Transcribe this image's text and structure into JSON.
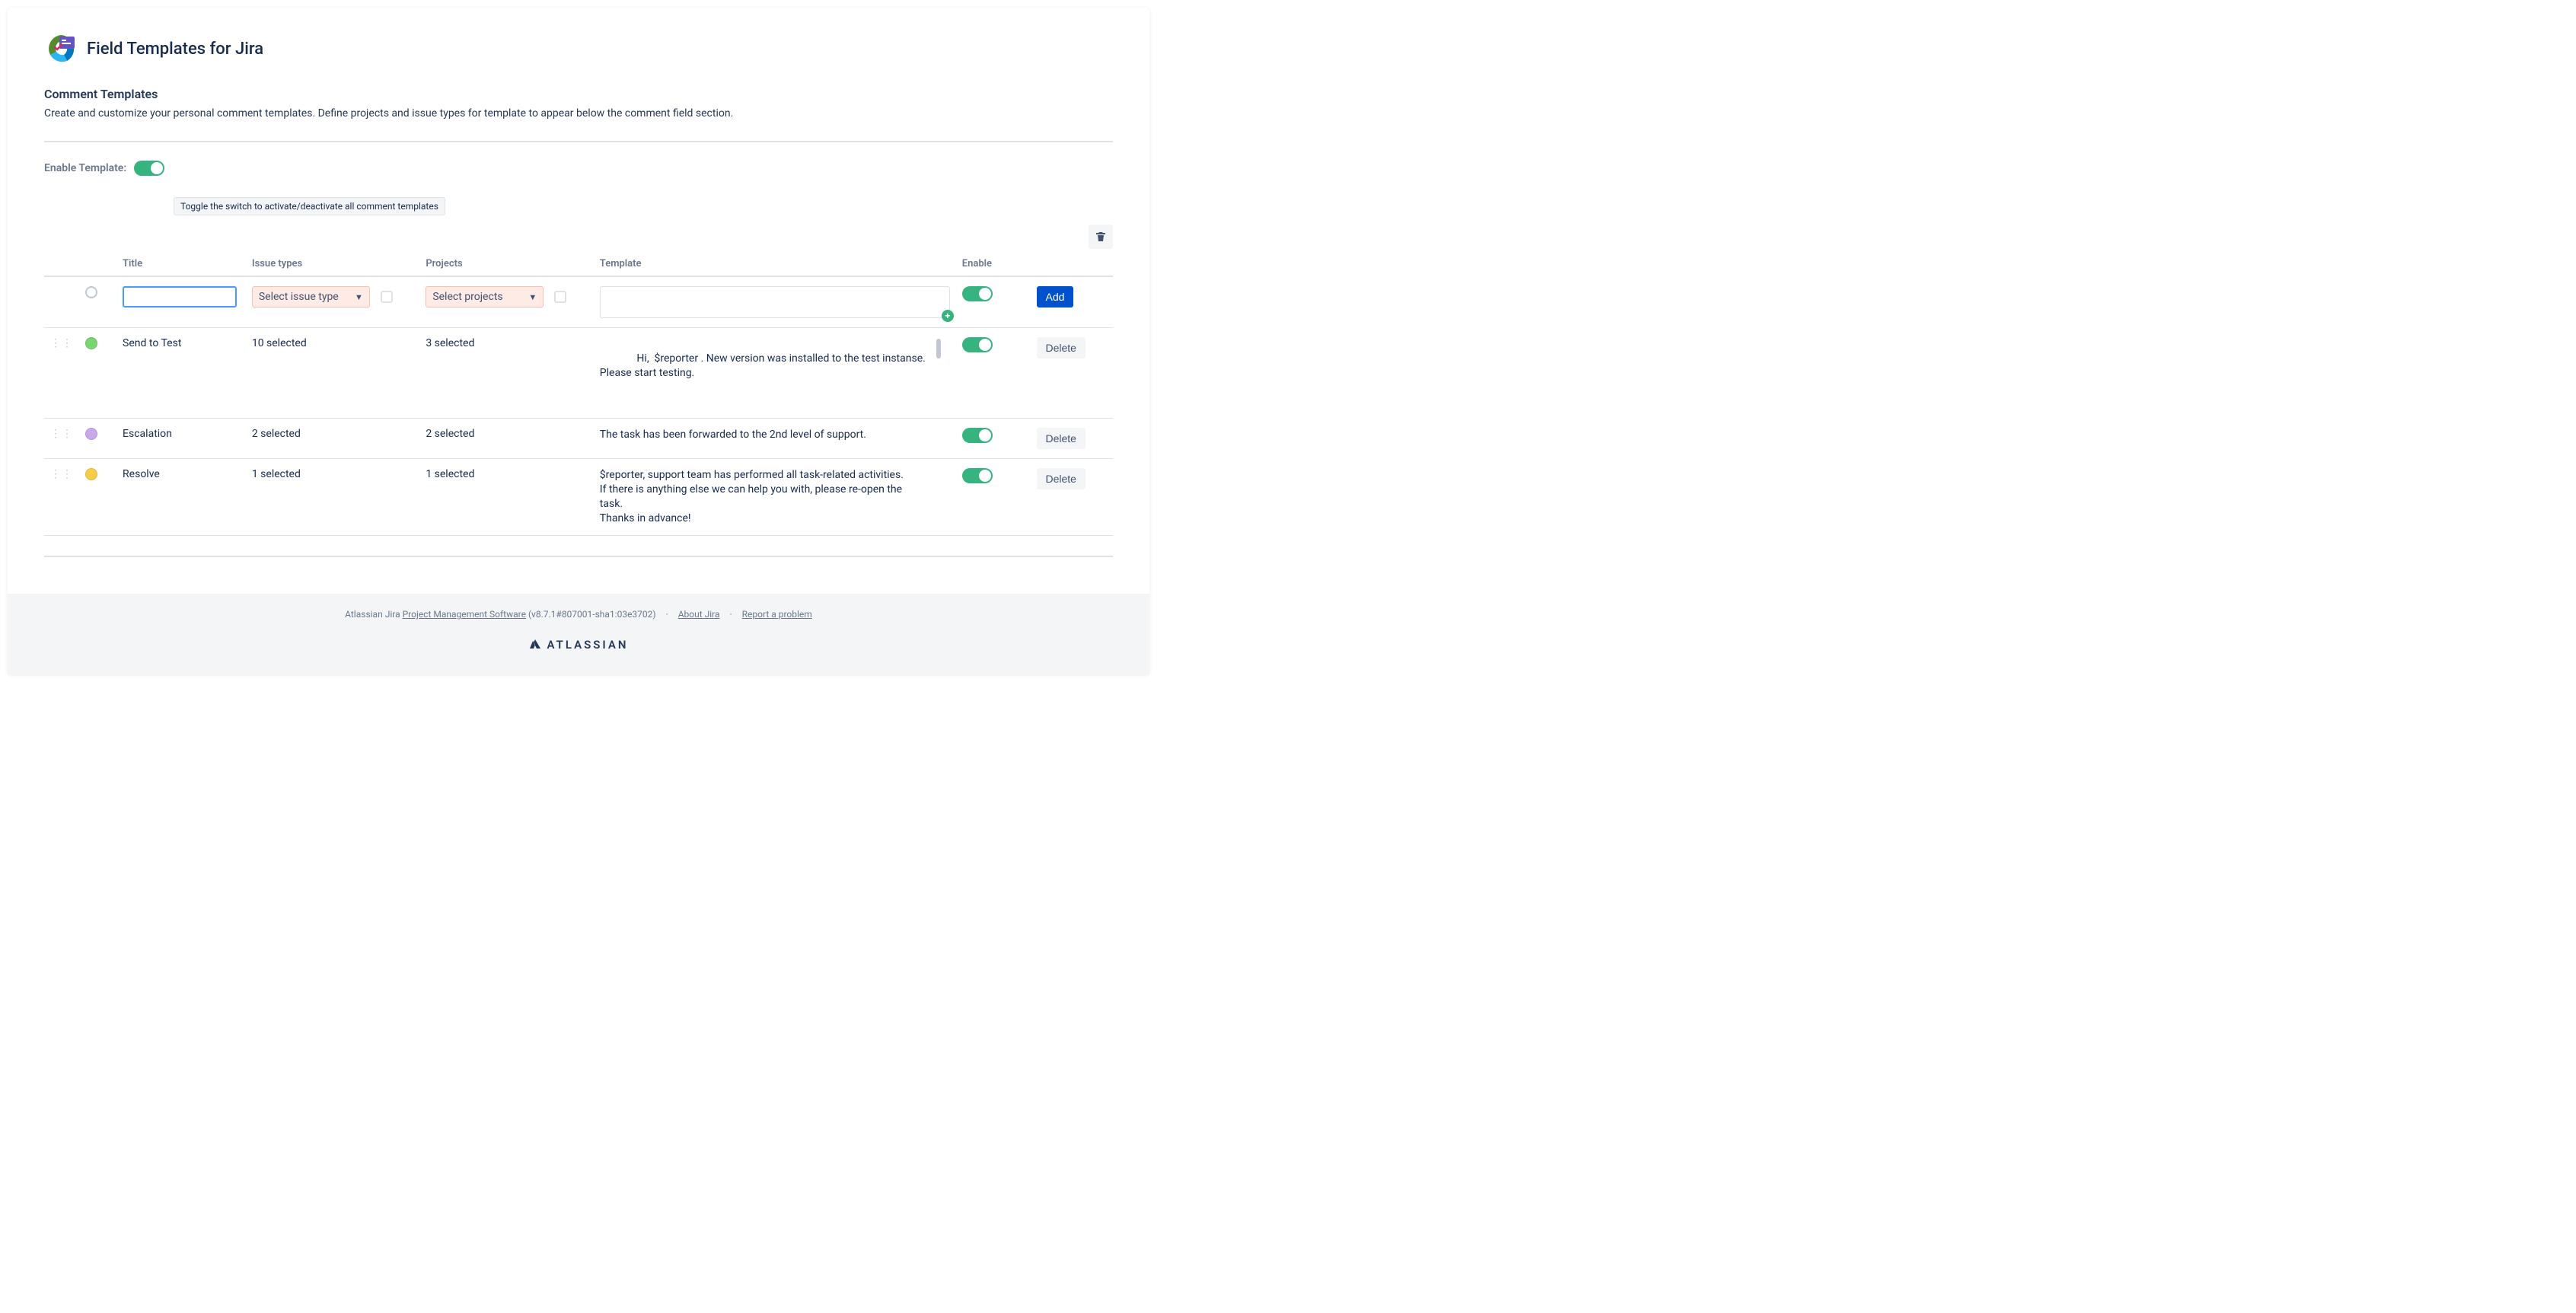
{
  "app": {
    "title": "Field Templates for Jira"
  },
  "section": {
    "title": "Comment Templates",
    "description": "Create and customize your personal comment templates. Define projects and issue types for template to appear below the comment field section."
  },
  "enable": {
    "label": "Enable Template:",
    "on": true,
    "tooltip": "Toggle the switch to activate/deactivate all comment templates"
  },
  "columns": {
    "title": "Title",
    "issue_types": "Issue types",
    "projects": "Projects",
    "template": "Template",
    "enable": "Enable"
  },
  "new_row": {
    "title_value": "",
    "issue_placeholder": "Select issue type",
    "project_placeholder": "Select projects",
    "template_value": "",
    "add_label": "Add"
  },
  "rows": [
    {
      "color": "green",
      "title": "Send to Test",
      "issue_types": "10 selected",
      "projects": "3 selected",
      "template": "Hi,  $reporter . New version was installed to the test instanse. Please start testing.",
      "has_scroll": true,
      "delete_label": "Delete"
    },
    {
      "color": "purple",
      "title": "Escalation",
      "issue_types": "2 selected",
      "projects": "2 selected",
      "template": "The task has been forwarded to the 2nd level of support.",
      "has_scroll": false,
      "delete_label": "Delete"
    },
    {
      "color": "yellow",
      "title": "Resolve",
      "issue_types": "1 selected",
      "projects": "1 selected",
      "template": "$reporter, support team has performed all task-related activities.\nIf there is anything else we can help you with, please re-open the task.\nThanks in advance!",
      "has_scroll": false,
      "delete_label": "Delete"
    }
  ],
  "footer": {
    "prefix": "Atlassian Jira ",
    "link1": "Project Management Software",
    "version": " (v8.7.1#807001-sha1:03e3702)",
    "link2": "About Jira",
    "link3": "Report a problem",
    "brand": "ATLASSIAN"
  }
}
